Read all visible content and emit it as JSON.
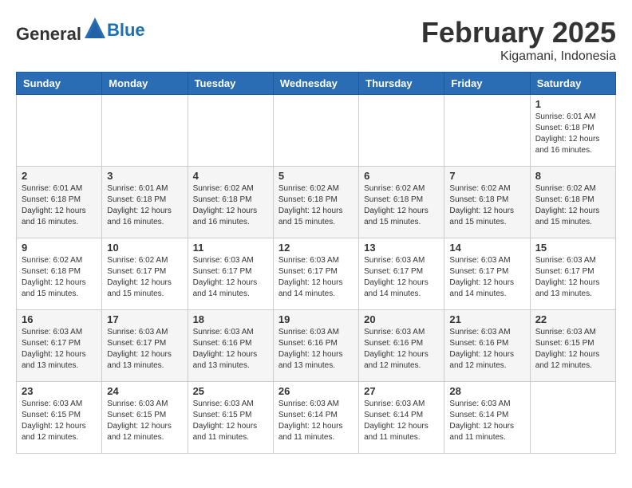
{
  "header": {
    "logo_general": "General",
    "logo_blue": "Blue",
    "month": "February 2025",
    "location": "Kigamani, Indonesia"
  },
  "weekdays": [
    "Sunday",
    "Monday",
    "Tuesday",
    "Wednesday",
    "Thursday",
    "Friday",
    "Saturday"
  ],
  "weeks": [
    [
      {
        "day": "",
        "info": ""
      },
      {
        "day": "",
        "info": ""
      },
      {
        "day": "",
        "info": ""
      },
      {
        "day": "",
        "info": ""
      },
      {
        "day": "",
        "info": ""
      },
      {
        "day": "",
        "info": ""
      },
      {
        "day": "1",
        "info": "Sunrise: 6:01 AM\nSunset: 6:18 PM\nDaylight: 12 hours\nand 16 minutes."
      }
    ],
    [
      {
        "day": "2",
        "info": "Sunrise: 6:01 AM\nSunset: 6:18 PM\nDaylight: 12 hours\nand 16 minutes."
      },
      {
        "day": "3",
        "info": "Sunrise: 6:01 AM\nSunset: 6:18 PM\nDaylight: 12 hours\nand 16 minutes."
      },
      {
        "day": "4",
        "info": "Sunrise: 6:02 AM\nSunset: 6:18 PM\nDaylight: 12 hours\nand 16 minutes."
      },
      {
        "day": "5",
        "info": "Sunrise: 6:02 AM\nSunset: 6:18 PM\nDaylight: 12 hours\nand 15 minutes."
      },
      {
        "day": "6",
        "info": "Sunrise: 6:02 AM\nSunset: 6:18 PM\nDaylight: 12 hours\nand 15 minutes."
      },
      {
        "day": "7",
        "info": "Sunrise: 6:02 AM\nSunset: 6:18 PM\nDaylight: 12 hours\nand 15 minutes."
      },
      {
        "day": "8",
        "info": "Sunrise: 6:02 AM\nSunset: 6:18 PM\nDaylight: 12 hours\nand 15 minutes."
      }
    ],
    [
      {
        "day": "9",
        "info": "Sunrise: 6:02 AM\nSunset: 6:18 PM\nDaylight: 12 hours\nand 15 minutes."
      },
      {
        "day": "10",
        "info": "Sunrise: 6:02 AM\nSunset: 6:17 PM\nDaylight: 12 hours\nand 15 minutes."
      },
      {
        "day": "11",
        "info": "Sunrise: 6:03 AM\nSunset: 6:17 PM\nDaylight: 12 hours\nand 14 minutes."
      },
      {
        "day": "12",
        "info": "Sunrise: 6:03 AM\nSunset: 6:17 PM\nDaylight: 12 hours\nand 14 minutes."
      },
      {
        "day": "13",
        "info": "Sunrise: 6:03 AM\nSunset: 6:17 PM\nDaylight: 12 hours\nand 14 minutes."
      },
      {
        "day": "14",
        "info": "Sunrise: 6:03 AM\nSunset: 6:17 PM\nDaylight: 12 hours\nand 14 minutes."
      },
      {
        "day": "15",
        "info": "Sunrise: 6:03 AM\nSunset: 6:17 PM\nDaylight: 12 hours\nand 13 minutes."
      }
    ],
    [
      {
        "day": "16",
        "info": "Sunrise: 6:03 AM\nSunset: 6:17 PM\nDaylight: 12 hours\nand 13 minutes."
      },
      {
        "day": "17",
        "info": "Sunrise: 6:03 AM\nSunset: 6:17 PM\nDaylight: 12 hours\nand 13 minutes."
      },
      {
        "day": "18",
        "info": "Sunrise: 6:03 AM\nSunset: 6:16 PM\nDaylight: 12 hours\nand 13 minutes."
      },
      {
        "day": "19",
        "info": "Sunrise: 6:03 AM\nSunset: 6:16 PM\nDaylight: 12 hours\nand 13 minutes."
      },
      {
        "day": "20",
        "info": "Sunrise: 6:03 AM\nSunset: 6:16 PM\nDaylight: 12 hours\nand 12 minutes."
      },
      {
        "day": "21",
        "info": "Sunrise: 6:03 AM\nSunset: 6:16 PM\nDaylight: 12 hours\nand 12 minutes."
      },
      {
        "day": "22",
        "info": "Sunrise: 6:03 AM\nSunset: 6:15 PM\nDaylight: 12 hours\nand 12 minutes."
      }
    ],
    [
      {
        "day": "23",
        "info": "Sunrise: 6:03 AM\nSunset: 6:15 PM\nDaylight: 12 hours\nand 12 minutes."
      },
      {
        "day": "24",
        "info": "Sunrise: 6:03 AM\nSunset: 6:15 PM\nDaylight: 12 hours\nand 12 minutes."
      },
      {
        "day": "25",
        "info": "Sunrise: 6:03 AM\nSunset: 6:15 PM\nDaylight: 12 hours\nand 11 minutes."
      },
      {
        "day": "26",
        "info": "Sunrise: 6:03 AM\nSunset: 6:14 PM\nDaylight: 12 hours\nand 11 minutes."
      },
      {
        "day": "27",
        "info": "Sunrise: 6:03 AM\nSunset: 6:14 PM\nDaylight: 12 hours\nand 11 minutes."
      },
      {
        "day": "28",
        "info": "Sunrise: 6:03 AM\nSunset: 6:14 PM\nDaylight: 12 hours\nand 11 minutes."
      },
      {
        "day": "",
        "info": ""
      }
    ]
  ]
}
